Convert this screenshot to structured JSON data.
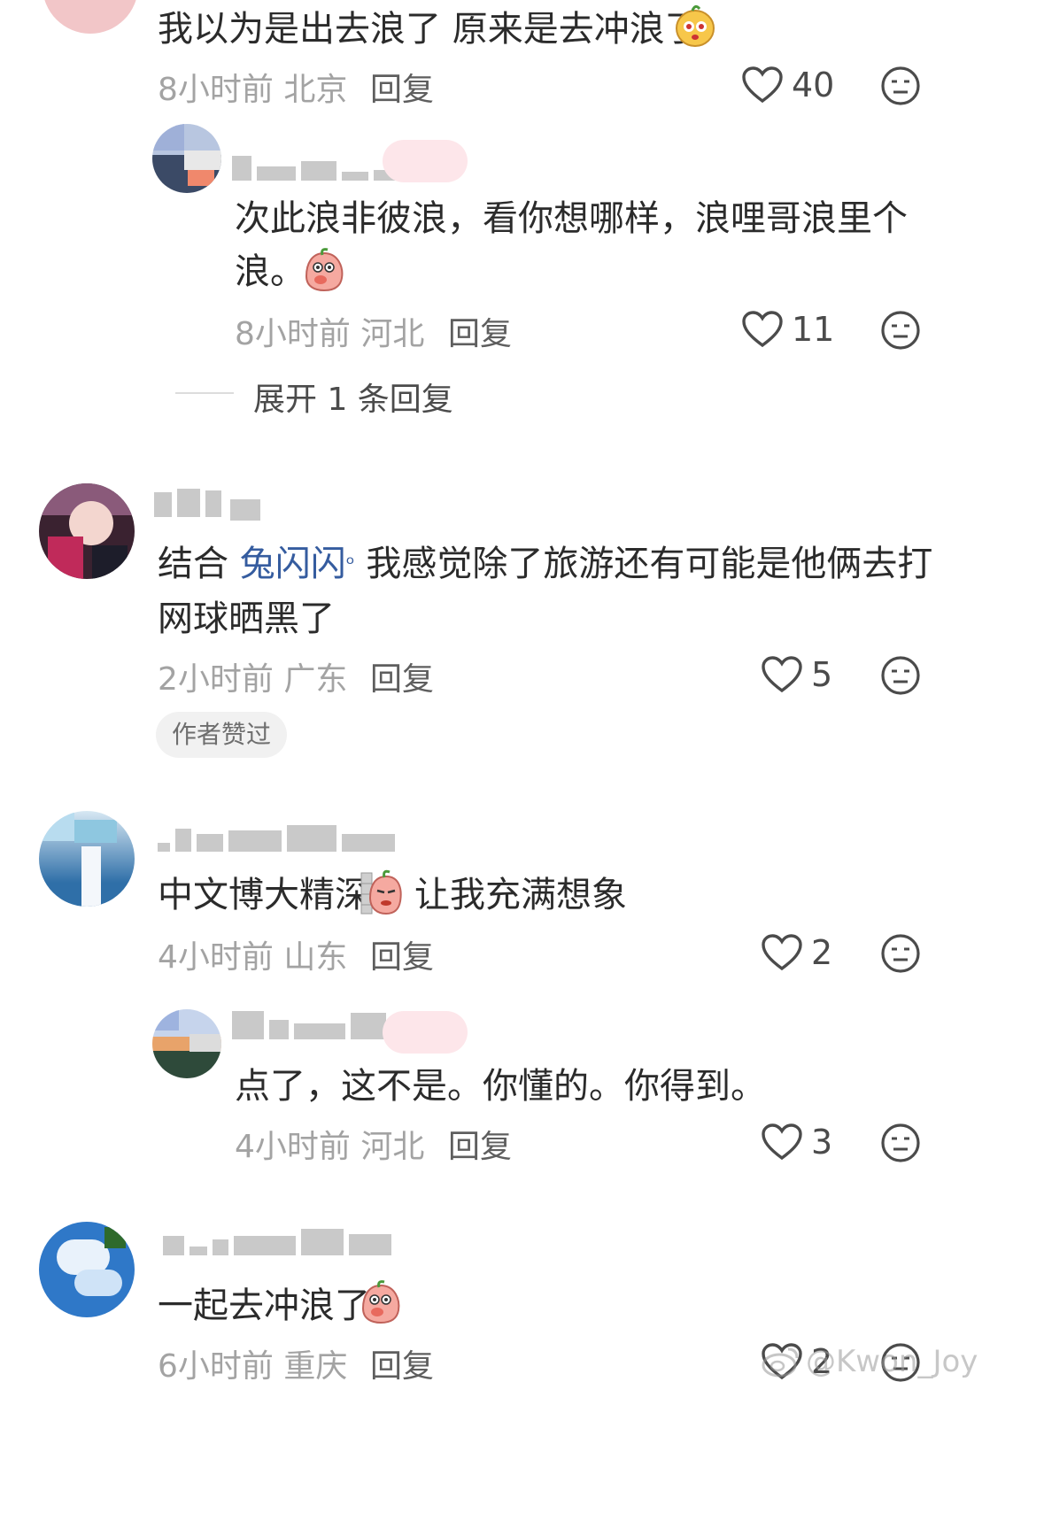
{
  "comments": [
    {
      "text": "我以为是出去浪了 原来是去冲浪了",
      "time": "8小时前",
      "location": "北京",
      "reply_label": "回复",
      "likes": "40"
    },
    {
      "text_line1": "次此浪非彼浪，看你想哪样，浪哩哥浪里个",
      "text_line2": "浪。",
      "time": "8小时前",
      "location": "河北",
      "reply_label": "回复",
      "likes": "11",
      "expand_label": "展开 1 条回复"
    },
    {
      "prefix": "结合 ",
      "mention": "兔闪闪",
      "text_after": "  我感觉除了旅游还有可能是他俩去打",
      "text_line2": "网球晒黑了",
      "time": "2小时前",
      "location": "广东",
      "reply_label": "回复",
      "likes": "5",
      "badge": "作者赞过"
    },
    {
      "text_before": "中文博大精深",
      "text_after": "让我充满想象",
      "time": "4小时前",
      "location": "山东",
      "reply_label": "回复",
      "likes": "2"
    },
    {
      "text": "点了，这不是。你懂的。你得到。",
      "time": "4小时前",
      "location": "河北",
      "reply_label": "回复",
      "likes": "3"
    },
    {
      "text": "一起去冲浪了",
      "time": "6小时前",
      "location": "重庆",
      "reply_label": "回复",
      "likes": "2"
    }
  ],
  "watermark": "@Kwon_Joy",
  "colors": {
    "mention": "#355c9f",
    "author_tag": "#ff4a6e",
    "meta": "#a3a3a3"
  }
}
